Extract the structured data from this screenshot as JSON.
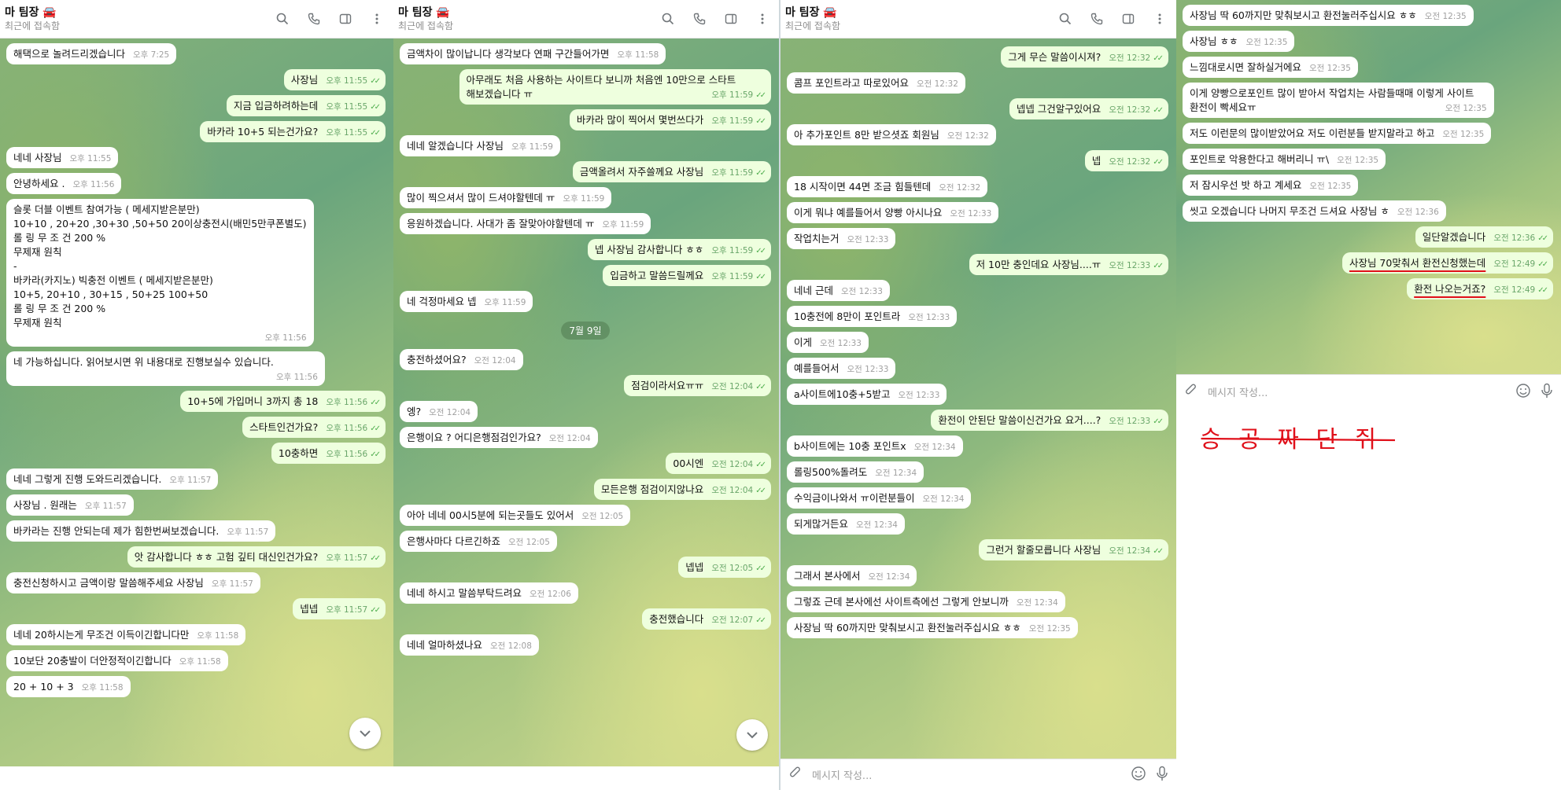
{
  "header": {
    "title": "마 팀장",
    "subtitle": "최근에 접속함"
  },
  "composer": {
    "placeholder": "메시지 작성..."
  },
  "panels": [
    {
      "messages": [
        {
          "dir": "in",
          "text": "해택으로 놀려드리겠습니다",
          "time": "오후 7:25"
        },
        {
          "dir": "out",
          "text": "사장님",
          "time": "오후 11:55"
        },
        {
          "dir": "out",
          "text": "지금 입금하려하는데",
          "time": "오후 11:55"
        },
        {
          "dir": "out",
          "text": "바카라 10+5 되는건가요?",
          "time": "오후 11:55"
        },
        {
          "dir": "in",
          "text": "네네 사장님",
          "time": "오후 11:55"
        },
        {
          "dir": "in",
          "text": "안녕하세요 .",
          "time": "오후 11:56"
        },
        {
          "dir": "in",
          "lines": [
            "슬롯 더블 이벤트 참여가능 ( 메세지받은분만)",
            "10+10 , 20+20 ,30+30 ,50+50   20이상충전시(배민5만쿠폰별도)",
            "롤 링 무 조 건 200 %",
            "무제재 원칙",
            "-",
            "바카라(카지노) 빅충전 이벤트 ( 메세지받은분만)",
            "10+5,  20+10 , 30+15 , 50+25 100+50",
            "롤 링 무 조 건 200 %",
            "무제재 원칙"
          ],
          "time": "오후 11:56"
        },
        {
          "dir": "in",
          "text": "네 가능하십니다. 읽어보시면 위 내용대로 진행보실수 있습니다.",
          "time": "오후 11:56"
        },
        {
          "dir": "out",
          "text": "10+5에 가입머니 3까지 총 18",
          "time": "오후 11:56"
        },
        {
          "dir": "out",
          "text": "스타트인건가요?",
          "time": "오후 11:56"
        },
        {
          "dir": "out",
          "text": "10충하면",
          "time": "오후 11:56"
        },
        {
          "dir": "in",
          "text": "네네 그렇게 진행 도와드리겠습니다.",
          "time": "오후 11:57"
        },
        {
          "dir": "in",
          "text": "사장님 . 원래는",
          "time": "오후 11:57"
        },
        {
          "dir": "in",
          "text": "바카라는 진행 안되는데 제가 힘한번써보겠습니다.",
          "time": "오후 11:57"
        },
        {
          "dir": "out",
          "text": "앗 감사합니다 ㅎㅎ 고험 깊티 대신인건가요?",
          "time": "오후 11:57"
        },
        {
          "dir": "in",
          "text": "충전신청하시고 금액이랑 말씀해주세요 사장님",
          "time": "오후 11:57"
        },
        {
          "dir": "out",
          "text": "넵넵",
          "time": "오후 11:57"
        },
        {
          "dir": "in",
          "text": "네네 20하시는게 무조건 이득이긴합니다만",
          "time": "오후 11:58"
        },
        {
          "dir": "in",
          "text": "10보단 20충발이 더안정적이긴합니다",
          "time": "오후 11:58"
        },
        {
          "dir": "in",
          "text": "20 + 10 + 3",
          "time": "오후 11:58"
        }
      ]
    },
    {
      "messages": [
        {
          "dir": "in",
          "text": "금액차이 많이납니다 생각보다 연패 구간들어가면",
          "time": "오후 11:58"
        },
        {
          "dir": "out",
          "text": "아무래도 처음 사용하는 사이트다 보니까 처음엔 10만으로 스타트 해보겠습니다 ㅠ",
          "time": "오후 11:59"
        },
        {
          "dir": "out",
          "text": "바카라 많이 찍어서 몇번쓰다가",
          "time": "오후 11:59"
        },
        {
          "dir": "in",
          "text": "네네 알겠습니다 사장님",
          "time": "오후 11:59"
        },
        {
          "dir": "out",
          "text": "금액올려서 자주쓸께요 사장님",
          "time": "오후 11:59"
        },
        {
          "dir": "in",
          "text": "많이 찍으셔서 많이 드셔야할텐데 ㅠ",
          "time": "오후 11:59"
        },
        {
          "dir": "in",
          "text": "응원하겠습니다. 사대가 좀 잘맞아야할텐데 ㅠ",
          "time": "오후 11:59"
        },
        {
          "dir": "out",
          "text": "넵 사장님 감사합니다 ㅎㅎ",
          "time": "오후 11:59"
        },
        {
          "dir": "out",
          "text": "입금하고 말씀드릴께요",
          "time": "오후 11:59"
        },
        {
          "dir": "in",
          "text": "네 걱정마세요 넵",
          "time": "오후 11:59"
        },
        {
          "dir": "date",
          "text": "7월 9일"
        },
        {
          "dir": "in",
          "text": "충전하셨어요?",
          "time": "오전 12:04"
        },
        {
          "dir": "out",
          "text": "점검이라서요ㅠㅠ",
          "time": "오전 12:04"
        },
        {
          "dir": "in",
          "text": "엥?",
          "time": "오전 12:04"
        },
        {
          "dir": "in",
          "text": "은행이요 ? 어디은행점검인가요?",
          "time": "오전 12:04"
        },
        {
          "dir": "out",
          "text": "00시엔",
          "time": "오전 12:04"
        },
        {
          "dir": "out",
          "text": "모든은행 점검이지않나요",
          "time": "오전 12:04"
        },
        {
          "dir": "in",
          "text": "아아 네네 00시5분에 되는곳들도 있어서",
          "time": "오전 12:05"
        },
        {
          "dir": "in",
          "text": "은행사마다 다르긴하죠",
          "time": "오전 12:05"
        },
        {
          "dir": "out",
          "text": "넵넵",
          "time": "오전 12:05"
        },
        {
          "dir": "in",
          "text": "네네 하시고 말씀부탁드려요",
          "time": "오전 12:06"
        },
        {
          "dir": "out",
          "text": "충전했습니다",
          "time": "오전 12:07"
        },
        {
          "dir": "in",
          "text": "네네 얼마하셨나요",
          "time": "오전 12:08"
        }
      ]
    },
    {
      "messages": [
        {
          "dir": "out",
          "text": "그게 무슨 말씀이시져?",
          "time": "오전 12:32"
        },
        {
          "dir": "in",
          "text": "콤프 포인트라고 따로있어요",
          "time": "오전 12:32"
        },
        {
          "dir": "out",
          "text": "넵넵 그건알구있어요",
          "time": "오전 12:32"
        },
        {
          "dir": "in",
          "text": "아 추가포인트 8만 받으셧죠 회원님",
          "time": "오전 12:32"
        },
        {
          "dir": "out",
          "text": "넵",
          "time": "오전 12:32"
        },
        {
          "dir": "in",
          "text": "18 시작이면 44면 조금 힘들텐데",
          "time": "오전 12:32"
        },
        {
          "dir": "in",
          "text": "이게 뭐냐 예를들어서 양빵 아시나요",
          "time": "오전 12:33"
        },
        {
          "dir": "in",
          "text": "작업치는거",
          "time": "오전 12:33"
        },
        {
          "dir": "out",
          "text": "저 10만 충인데요 사장님....ㅠ",
          "time": "오전 12:33"
        },
        {
          "dir": "in",
          "text": "네네 근데",
          "time": "오전 12:33"
        },
        {
          "dir": "in",
          "text": "10충전에 8만이 포인트라",
          "time": "오전 12:33"
        },
        {
          "dir": "in",
          "text": "이게",
          "time": "오전 12:33"
        },
        {
          "dir": "in",
          "text": "예를들어서",
          "time": "오전 12:33"
        },
        {
          "dir": "in",
          "text": "a사이트에10충+5받고",
          "time": "오전 12:33"
        },
        {
          "dir": "out",
          "text": "환전이 안된단 말씀이신건가요 요거....?",
          "time": "오전 12:33"
        },
        {
          "dir": "in",
          "text": "b사이트에는 10충 포인트x",
          "time": "오전 12:34"
        },
        {
          "dir": "in",
          "text": "롤링500%돌려도",
          "time": "오전 12:34"
        },
        {
          "dir": "in",
          "text": "수익금이나와서 ㅠ이런분들이",
          "time": "오전 12:34"
        },
        {
          "dir": "in",
          "text": "되게많거든요",
          "time": "오전 12:34"
        },
        {
          "dir": "out",
          "text": "그런거 할줄모릅니다 사장님",
          "time": "오전 12:34"
        },
        {
          "dir": "in",
          "text": "그래서 본사에서",
          "time": "오전 12:34"
        },
        {
          "dir": "in",
          "text": "그렇죠 근데 본사에선 사이트측에선 그렇게 안보니까",
          "time": "오전 12:34"
        },
        {
          "dir": "in",
          "text": "사장님 딱 60까지만 맞춰보시고 환전눌러주십시요 ㅎㅎ",
          "time": "오전 12:35"
        }
      ]
    },
    {
      "messages": [
        {
          "dir": "in",
          "text": "사장님 딱 60까지만 맞춰보시고 환전눌러주십시요 ㅎㅎ",
          "time": "오전 12:35"
        },
        {
          "dir": "in",
          "text": "사장님 ㅎㅎ",
          "time": "오전 12:35"
        },
        {
          "dir": "in",
          "text": "느낌대로시면 잘하실거에요",
          "time": "오전 12:35"
        },
        {
          "dir": "in",
          "text": "이게 양빵으로포인트 많이 받아서 작업치는 사람들때매 이렇게 사이트 환전이 빡세요ㅠ",
          "time": "오전 12:35"
        },
        {
          "dir": "in",
          "text": "저도 이런문의 많이받았어요 저도 이런분들 받지말라고 하고",
          "time": "오전 12:35"
        },
        {
          "dir": "in",
          "text": "포인트로 악용한다고 해버리니 ㅠ\\",
          "time": "오전 12:35"
        },
        {
          "dir": "in",
          "text": "저 잠시우선 밧 하고 계세요",
          "time": "오전 12:35"
        },
        {
          "dir": "in",
          "text": "씻고 오겠습니다 나머지 무조건 드셔요 사장님 ㅎ",
          "time": "오전 12:36"
        },
        {
          "dir": "out",
          "text": "일단알겠습니다",
          "time": "오전 12:36"
        },
        {
          "dir": "out",
          "text": "사장님 70맞춰서 환전신청했는데",
          "time": "오전 12:49",
          "underline": true
        },
        {
          "dir": "out",
          "text": "환전 나오는거죠?",
          "time": "오전 12:49",
          "underline": true
        }
      ]
    }
  ],
  "annotation": {
    "text": "승 공 짜 단 쥐"
  },
  "colors": {
    "outgoing": "#eeffde",
    "incoming": "#ffffff",
    "tick": "#4fae4e",
    "red_mark": "#e0101a"
  },
  "icons": [
    "search-icon",
    "phone-icon",
    "sidebar-icon",
    "more-icon",
    "attach-icon",
    "emoji-icon",
    "mic-icon",
    "chevron-down-icon",
    "car-icon"
  ]
}
